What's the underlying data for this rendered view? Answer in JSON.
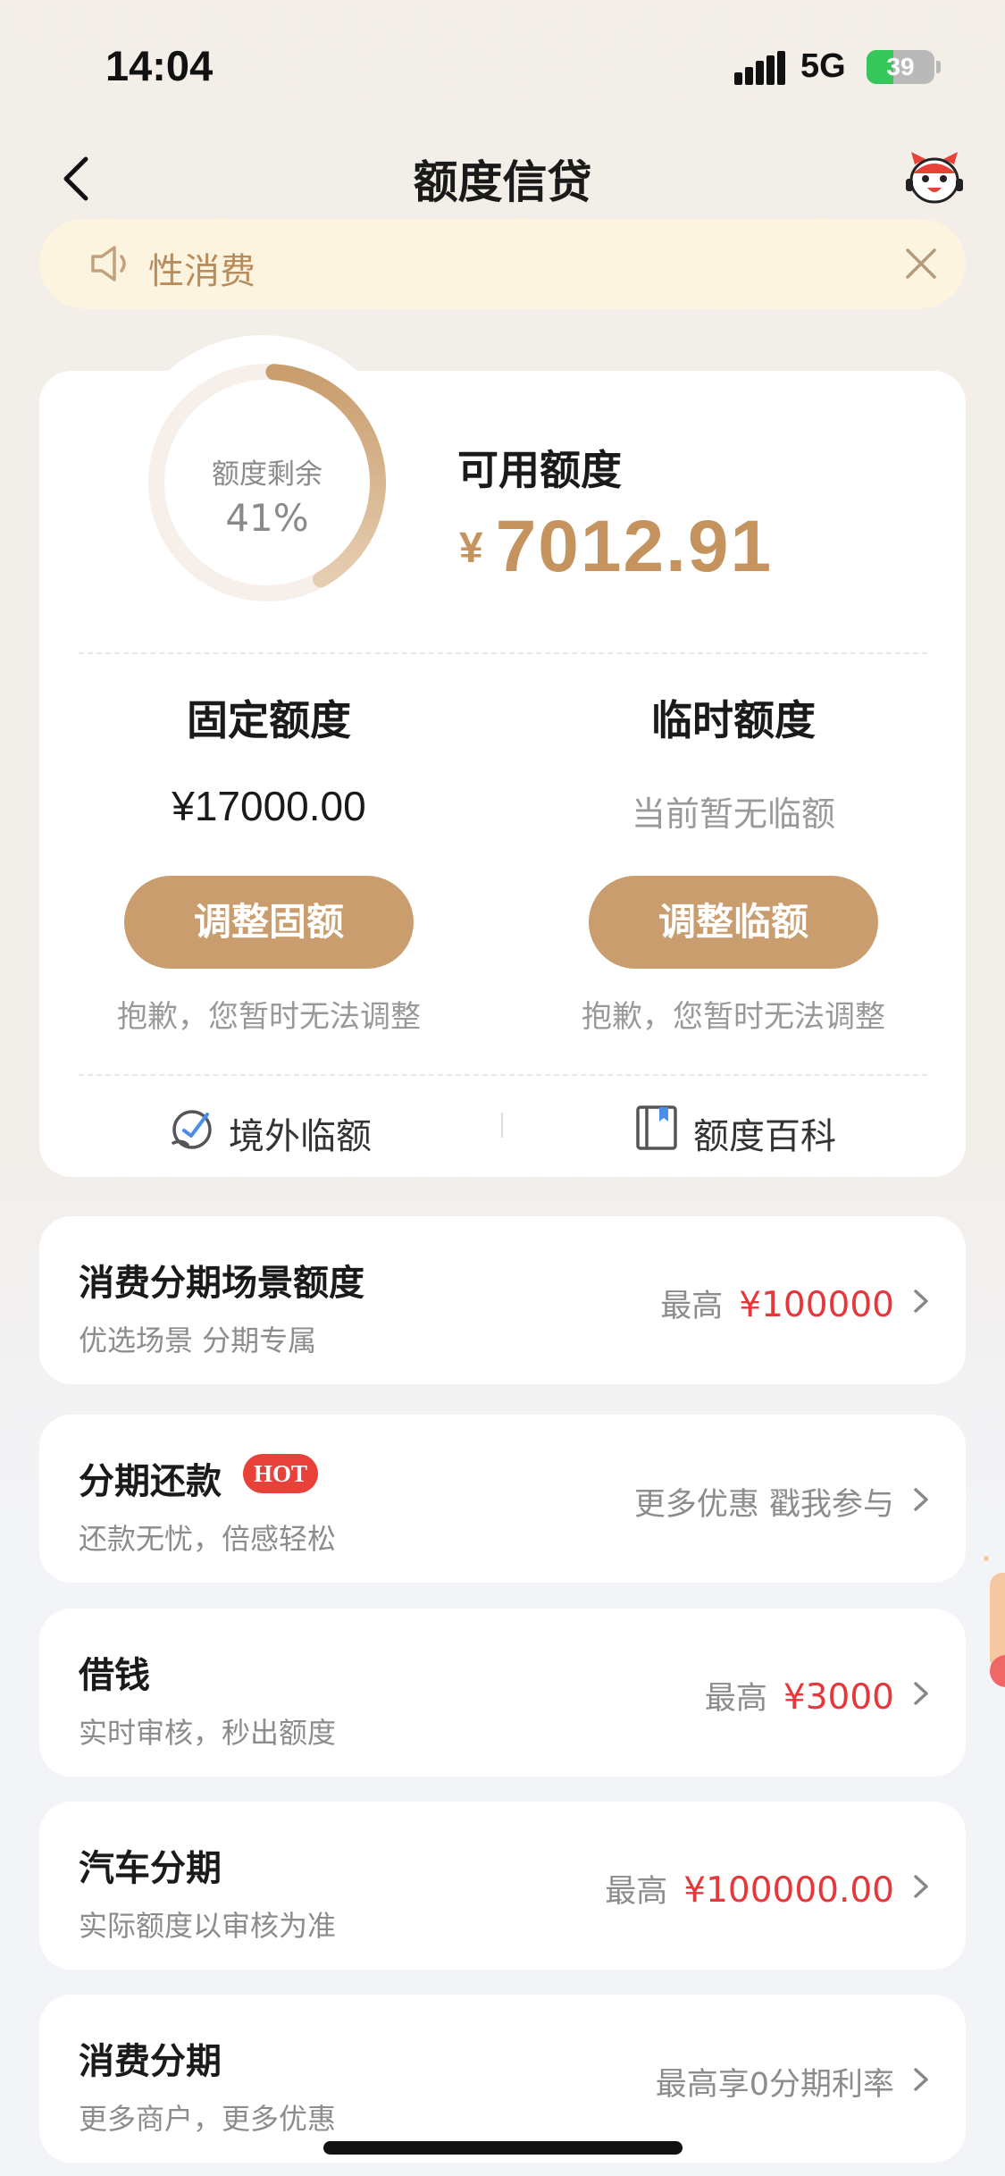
{
  "status_bar": {
    "time": "14:04",
    "network": "5G",
    "battery": 39
  },
  "nav": {
    "title": "额度信贷"
  },
  "notice": {
    "text": "性消费"
  },
  "credit": {
    "ring_label": "额度剩余",
    "ring_percent_text": "41%",
    "remaining_fraction": 0.41,
    "available_label": "可用额度",
    "currency": "¥",
    "available_amount": "7012.91",
    "fixed": {
      "title": "固定额度",
      "value": "¥17000.00",
      "button": "调整固额",
      "hint": "抱歉，您暂时无法调整"
    },
    "temporary": {
      "title": "临时额度",
      "value": "当前暂无临额",
      "button": "调整临额",
      "hint": "抱歉，您暂时无法调整"
    },
    "links": {
      "overseas": "境外临额",
      "wiki": "额度百科"
    }
  },
  "list": [
    {
      "title": "消费分期场景额度",
      "subtitle": "优选场景 分期专属",
      "prefix": "最高",
      "amount": "¥100000"
    },
    {
      "title": "分期还款",
      "badge": "HOT",
      "subtitle": "还款无忧，倍感轻松",
      "prefix": "更多优惠 戳我参与",
      "amount": ""
    },
    {
      "title": "借钱",
      "subtitle": "实时审核，秒出额度",
      "prefix": "最高",
      "amount": "¥3000"
    },
    {
      "title": "汽车分期",
      "subtitle": "实际额度以审核为准",
      "prefix": "最高",
      "amount": "¥100000.00"
    },
    {
      "title": "消费分期",
      "subtitle": "更多商户，更多优惠",
      "prefix": "最高享0分期利率",
      "amount": ""
    }
  ],
  "colors": {
    "accent": "#c99d6d",
    "gold_text": "#c4935e",
    "red": "#e6383a",
    "hot": "#e8413a"
  }
}
